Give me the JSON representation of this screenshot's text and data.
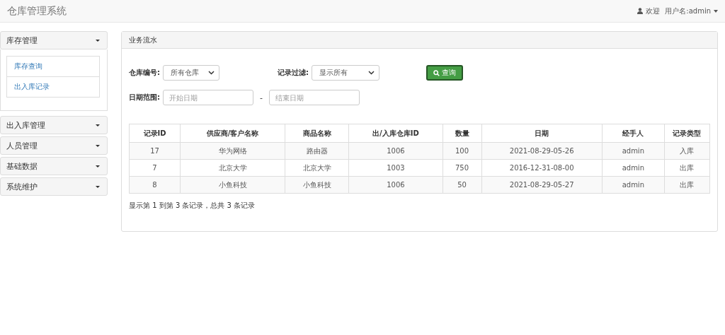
{
  "navbar": {
    "title": "仓库管理系统",
    "welcome": "欢迎",
    "user": "用户名:admin"
  },
  "sidebar": {
    "groups": [
      {
        "label": "库存管理",
        "children": [
          {
            "label": "库存查询"
          },
          {
            "label": "出入库记录"
          }
        ]
      },
      {
        "label": "出入库管理"
      },
      {
        "label": "人员管理"
      },
      {
        "label": "基础数据"
      },
      {
        "label": "系统维护"
      }
    ]
  },
  "panel": {
    "title": "业务流水",
    "filters": {
      "warehouse_label": "仓库编号:",
      "warehouse_value": "所有仓库",
      "record_label": "记录过滤:",
      "record_value": "显示所有",
      "query_button": "查询",
      "date_label": "日期范围:",
      "start_placeholder": "开始日期",
      "separator": "-",
      "end_placeholder": "结束日期"
    },
    "table": {
      "columns": [
        "记录ID",
        "供应商/客户名称",
        "商品名称",
        "出/入库仓库ID",
        "数量",
        "日期",
        "经手人",
        "记录类型"
      ],
      "rows": [
        [
          "17",
          "华为网络",
          "路由器",
          "1006",
          "100",
          "2021-08-29-05-26",
          "admin",
          "入库"
        ],
        [
          "7",
          "北京大学",
          "北京大学",
          "1003",
          "750",
          "2016-12-31-08-00",
          "admin",
          "出库"
        ],
        [
          "8",
          "小鱼科技",
          "小鱼科技",
          "1006",
          "50",
          "2021-08-29-05-27",
          "admin",
          "出库"
        ]
      ]
    },
    "pagination_info": "显示第 1 到第 3 条记录，总共 3 条记录"
  }
}
